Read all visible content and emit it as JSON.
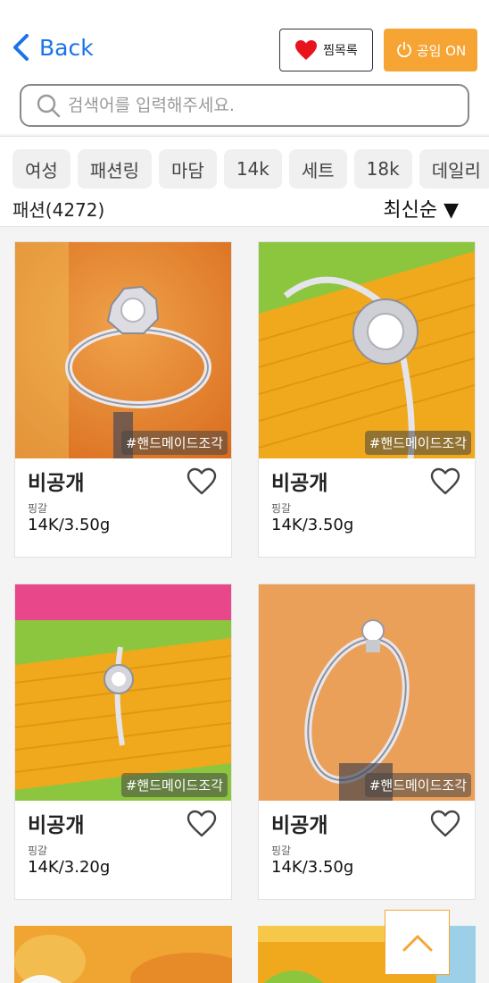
{
  "header": {
    "back_label": "Back",
    "wishlist_label": "찜목록",
    "public_label": "공임 ON"
  },
  "search": {
    "placeholder": "검색어를 입력해주세요."
  },
  "filters": {
    "chips": [
      "여성",
      "패션링",
      "마담",
      "14k",
      "세트",
      "18k",
      "데일리"
    ],
    "count_label": "패션(4272)",
    "sort_label": "최신순 ▼"
  },
  "products": [
    {
      "name": "비공개",
      "material": "핑갈",
      "spec": "14K/3.50g",
      "tag": "#핸드메이드조각",
      "image": "rose-ring-on-orange"
    },
    {
      "name": "비공개",
      "material": "핑갈",
      "spec": "14K/3.50g",
      "tag": "#핸드메이드조각",
      "image": "halo-ring-on-yellow-fabric"
    },
    {
      "name": "비공개",
      "material": "핑갈",
      "spec": "14K/3.20g",
      "tag": "#핸드메이드조각",
      "image": "halo-ring-on-yellow-fabric-pink-bg"
    },
    {
      "name": "비공개",
      "material": "핑갈",
      "spec": "14K/3.50g",
      "tag": "#핸드메이드조각",
      "image": "solitaire-ring-on-orange"
    }
  ],
  "colors": {
    "accent": "#f6a535",
    "link": "#1a73e8",
    "heart": "#e8131d"
  }
}
